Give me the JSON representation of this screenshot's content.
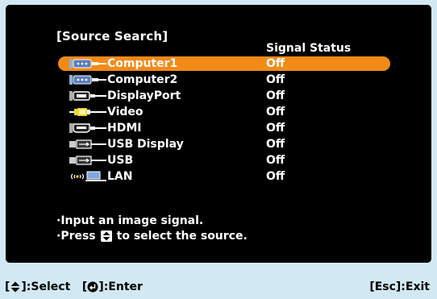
{
  "screen": {
    "title": "[Source Search]",
    "column_header": "Signal Status"
  },
  "sources": [
    {
      "name": "Computer1",
      "status": "Off",
      "icon": "computer-port-icon",
      "selected": true
    },
    {
      "name": "Computer2",
      "status": "Off",
      "icon": "computer-port-icon",
      "selected": false
    },
    {
      "name": "DisplayPort",
      "status": "Off",
      "icon": "displayport-icon",
      "selected": false
    },
    {
      "name": "Video",
      "status": "Off",
      "icon": "video-port-icon",
      "selected": false
    },
    {
      "name": "HDMI",
      "status": "Off",
      "icon": "hdmi-icon",
      "selected": false
    },
    {
      "name": "USB Display",
      "status": "Off",
      "icon": "usb-display-icon",
      "selected": false
    },
    {
      "name": "USB",
      "status": "Off",
      "icon": "usb-icon",
      "selected": false
    },
    {
      "name": "LAN",
      "status": "Off",
      "icon": "lan-icon",
      "selected": false
    }
  ],
  "messages": {
    "line1": "·Input an image signal.",
    "line2_prefix": "·Press",
    "line2_suffix": "to select the source."
  },
  "footer": {
    "select_label": "]:Select",
    "enter_label": "]:Enter",
    "exit_label": "[Esc]:Exit"
  },
  "colors": {
    "background": "#d2e9f4",
    "panel": "#000000",
    "highlight": "#f28a18"
  }
}
